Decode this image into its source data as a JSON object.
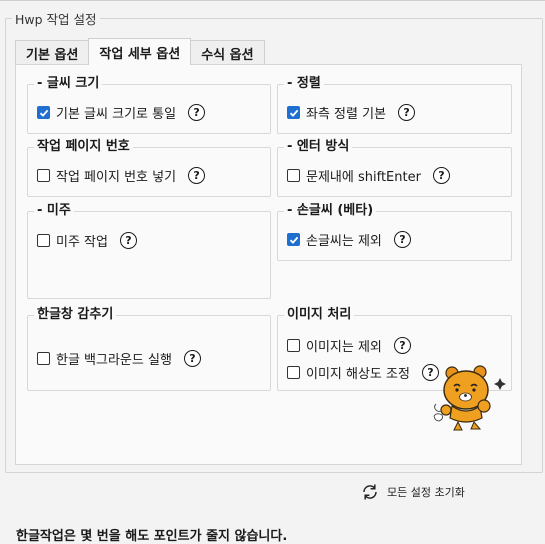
{
  "window": {
    "title": "Hwp 작업 설정"
  },
  "tabs": [
    {
      "label": "기본 옵션",
      "active": false
    },
    {
      "label": "작업 세부 옵션",
      "active": true
    },
    {
      "label": "수식 옵션",
      "active": false
    }
  ],
  "groups": {
    "font_size": {
      "title": "- 글씨 크기",
      "option": "기본 글씨 크기로 통일",
      "checked": true
    },
    "align": {
      "title": "- 정렬",
      "option": "좌측 정렬 기본",
      "checked": true
    },
    "page_number": {
      "title": "작업 페이지 번호",
      "option": "작업 페이지 번호 넣기",
      "checked": false
    },
    "enter": {
      "title": "- 엔터 방식",
      "option": "문제내에 shiftEnter",
      "checked": false
    },
    "footnote": {
      "title": "- 미주",
      "option": "미주 작업",
      "checked": false
    },
    "handwriting": {
      "title": "- 손글씨 (베타)",
      "option": "손글씨는 제외",
      "checked": true
    },
    "hide_window": {
      "title": "한글창 감추기",
      "option": "한글 백그라운드 실행",
      "checked": false
    },
    "image": {
      "title": "이미지 처리",
      "options": [
        {
          "label": "이미지는 제외",
          "checked": false
        },
        {
          "label": "이미지 해상도 조정",
          "checked": false
        }
      ]
    }
  },
  "help_glyph": "?",
  "reset": {
    "label": "모든 설정 초기화",
    "icon": "refresh-icon"
  },
  "footer": {
    "text": "한글작업은 몇 번을 해도 포인트가 줄지 않습니다."
  },
  "colors": {
    "accent": "#1f6fd1",
    "background": "#f3f3f3",
    "panel": "#fafafa"
  }
}
